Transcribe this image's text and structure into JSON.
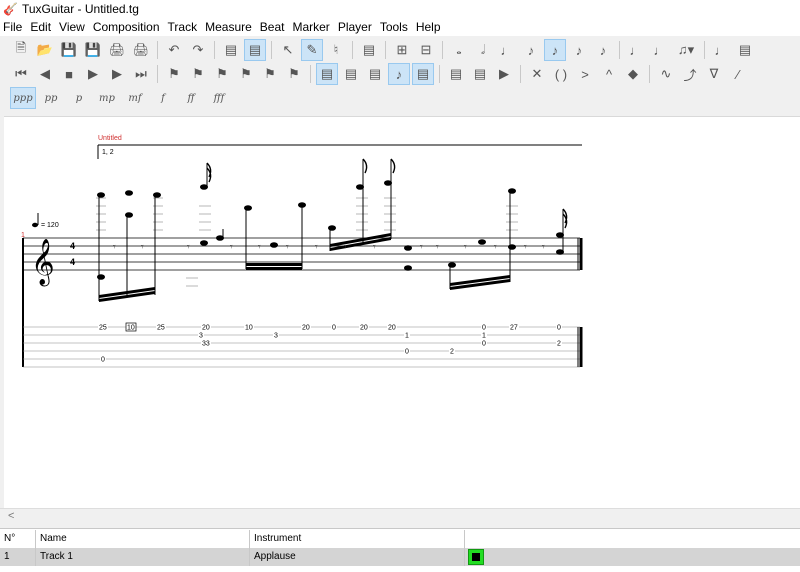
{
  "window": {
    "title": "TuxGuitar - Untitled.tg"
  },
  "menu": [
    "File",
    "Edit",
    "View",
    "Composition",
    "Track",
    "Measure",
    "Beat",
    "Marker",
    "Player",
    "Tools",
    "Help"
  ],
  "toolbar": {
    "dynamics": [
      "ppp",
      "pp",
      "p",
      "mp",
      "mf",
      "f",
      "ff",
      "fff"
    ]
  },
  "score": {
    "title": "Untitled",
    "measure_number": "1",
    "volta": "1, 2",
    "tempo": "= 120",
    "time_signature": {
      "top": "4",
      "bottom": "4"
    },
    "tab_frets": [
      {
        "string": 1,
        "fret": "25"
      },
      {
        "string": 1,
        "fret": "10",
        "boxed": true
      },
      {
        "string": 1,
        "fret": "25"
      },
      {
        "string": 1,
        "fret": "20"
      },
      {
        "string": 1,
        "fret": "10"
      },
      {
        "string": 1,
        "fret": "20"
      },
      {
        "string": 1,
        "fret": "0"
      },
      {
        "string": 1,
        "fret": "20"
      },
      {
        "string": 1,
        "fret": "20"
      },
      {
        "string": 1,
        "fret": "0"
      },
      {
        "string": 1,
        "fret": "27"
      },
      {
        "string": 1,
        "fret": "0"
      },
      {
        "string": 2,
        "fret": "3"
      },
      {
        "string": 2,
        "fret": "3"
      },
      {
        "string": 2,
        "fret": "1"
      },
      {
        "string": 2,
        "fret": "1"
      },
      {
        "string": 3,
        "fret": "33"
      },
      {
        "string": 3,
        "fret": "0"
      },
      {
        "string": 3,
        "fret": "2"
      },
      {
        "string": 4,
        "fret": "0"
      },
      {
        "string": 4,
        "fret": "2"
      },
      {
        "string": 5,
        "fret": "0"
      }
    ]
  },
  "tracks": {
    "columns": [
      "N°",
      "Name",
      "Instrument",
      ""
    ],
    "rows": [
      {
        "number": "1",
        "name": "Track 1",
        "instrument": "Applause",
        "color": "#22dd22"
      }
    ]
  }
}
